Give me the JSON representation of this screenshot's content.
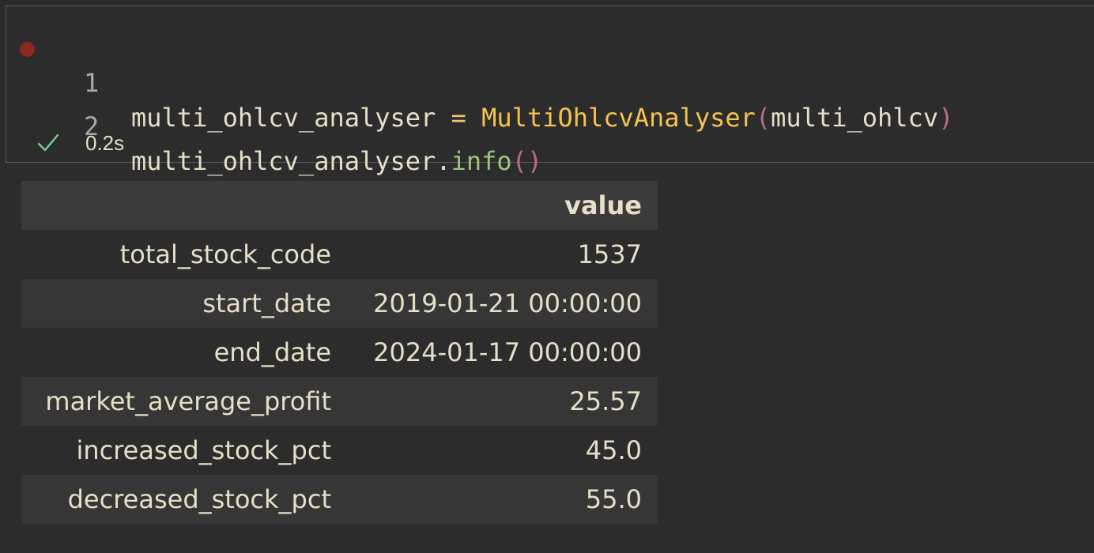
{
  "cell": {
    "lines": [
      {
        "number": "1",
        "var": "multi_ohlcv_analyser",
        "op": " = ",
        "cls": "MultiOhlcvAnalyser",
        "open": "(",
        "arg": "multi_ohlcv",
        "close": ")"
      },
      {
        "number": "2",
        "obj": "multi_ohlcv_analyser",
        "dot": ".",
        "method": "info",
        "parens": "()"
      }
    ],
    "status": {
      "icon": "check-icon",
      "duration": "0.2s"
    }
  },
  "table": {
    "column_header": "value",
    "rows": [
      {
        "label": "total_stock_code",
        "value": "1537"
      },
      {
        "label": "start_date",
        "value": "2019-01-21 00:00:00"
      },
      {
        "label": "end_date",
        "value": "2024-01-17 00:00:00"
      },
      {
        "label": "market_average_profit",
        "value": "25.57"
      },
      {
        "label": "increased_stock_pct",
        "value": "45.0"
      },
      {
        "label": "decreased_stock_pct",
        "value": "55.0"
      }
    ]
  },
  "colors": {
    "background": "#2c2c2c",
    "text": "#e6dfc6",
    "breakpoint": "#8b2a21",
    "success": "#73c991",
    "class_name": "#f5c24f",
    "method": "#9ac57c",
    "paren": "#c06a8a"
  }
}
